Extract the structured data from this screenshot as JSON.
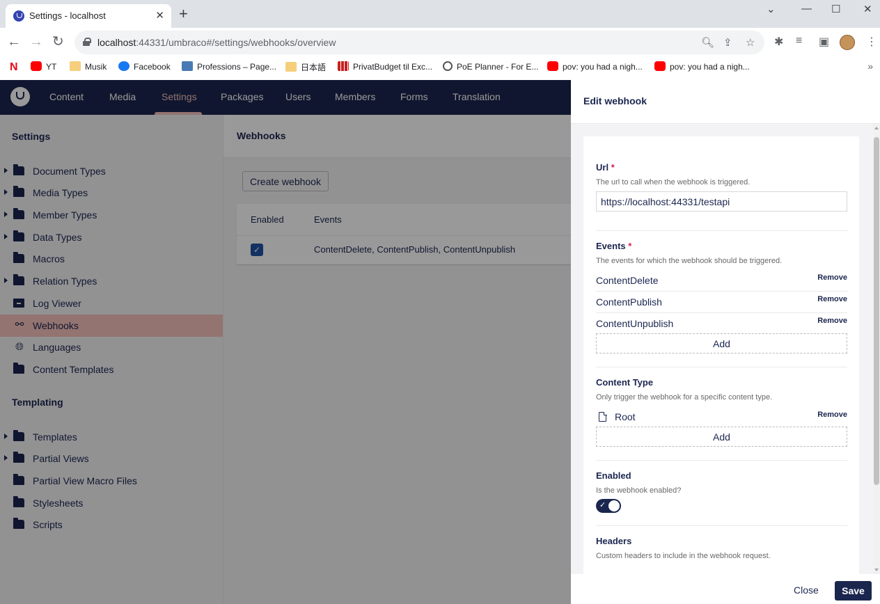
{
  "browser": {
    "tab_title": "Settings - localhost",
    "url_host": "localhost",
    "url_path": ":44331/umbraco#/settings/webhooks/overview",
    "bookmarks": [
      {
        "label": "",
        "icon": "netflix-icon"
      },
      {
        "label": "YT",
        "icon": "youtube-icon"
      },
      {
        "label": "Musik",
        "icon": "folder-icon"
      },
      {
        "label": "Facebook",
        "icon": "facebook-icon"
      },
      {
        "label": "Professions – Page...",
        "icon": "site-icon"
      },
      {
        "label": "日本語",
        "icon": "folder-icon"
      },
      {
        "label": "PrivatBudget til Exc...",
        "icon": "grid-icon"
      },
      {
        "label": "PoE Planner - For E...",
        "icon": "poe-icon"
      },
      {
        "label": "pov: you had a nigh...",
        "icon": "youtube-icon"
      },
      {
        "label": "pov: you had a nigh...",
        "icon": "youtube-icon"
      }
    ]
  },
  "topnav": {
    "items": [
      "Content",
      "Media",
      "Settings",
      "Packages",
      "Users",
      "Members",
      "Forms",
      "Translation"
    ],
    "active": "Settings"
  },
  "sidebar": {
    "settings_heading": "Settings",
    "settings_items": [
      {
        "label": "Document Types",
        "icon": "folder-icon"
      },
      {
        "label": "Media Types",
        "icon": "folder-icon"
      },
      {
        "label": "Member Types",
        "icon": "folder-icon"
      },
      {
        "label": "Data Types",
        "icon": "folder-icon"
      },
      {
        "label": "Macros",
        "icon": "folder-icon"
      },
      {
        "label": "Relation Types",
        "icon": "folder-icon"
      },
      {
        "label": "Log Viewer",
        "icon": "box-icon"
      },
      {
        "label": "Webhooks",
        "icon": "webhook-icon"
      },
      {
        "label": "Languages",
        "icon": "globe-icon"
      },
      {
        "label": "Content Templates",
        "icon": "folder-icon"
      }
    ],
    "templating_heading": "Templating",
    "templating_items": [
      {
        "label": "Templates",
        "icon": "folder-icon"
      },
      {
        "label": "Partial Views",
        "icon": "folder-icon"
      },
      {
        "label": "Partial View Macro Files",
        "icon": "folder-icon"
      },
      {
        "label": "Stylesheets",
        "icon": "folder-icon"
      },
      {
        "label": "Scripts",
        "icon": "folder-icon"
      }
    ]
  },
  "main": {
    "title": "Webhooks",
    "create_button": "Create webhook",
    "columns": [
      "Enabled",
      "Events"
    ],
    "rows": [
      {
        "enabled": true,
        "events": "ContentDelete, ContentPublish, ContentUnpublish"
      }
    ]
  },
  "panel": {
    "title": "Edit webhook",
    "url": {
      "label": "Url",
      "required": "*",
      "description": "The url to call when the webhook is triggered.",
      "value": "https://localhost:44331/testapi"
    },
    "events": {
      "label": "Events",
      "required": "*",
      "description": "The events for which the webhook should be triggered.",
      "items": [
        "ContentDelete",
        "ContentPublish",
        "ContentUnpublish"
      ],
      "remove_label": "Remove",
      "add_label": "Add"
    },
    "content_type": {
      "label": "Content Type",
      "description": "Only trigger the webhook for a specific content type.",
      "items": [
        "Root"
      ],
      "remove_label": "Remove",
      "add_label": "Add"
    },
    "enabled": {
      "label": "Enabled",
      "description": "Is the webhook enabled?",
      "value": true
    },
    "headers": {
      "label": "Headers",
      "description": "Custom headers to include in the webhook request."
    },
    "close_label": "Close",
    "save_label": "Save"
  },
  "colors": {
    "nav_bg": "#1b264f",
    "active_accent": "#f5c1bc",
    "save_bg": "#1b264f",
    "required": "#d42054"
  }
}
